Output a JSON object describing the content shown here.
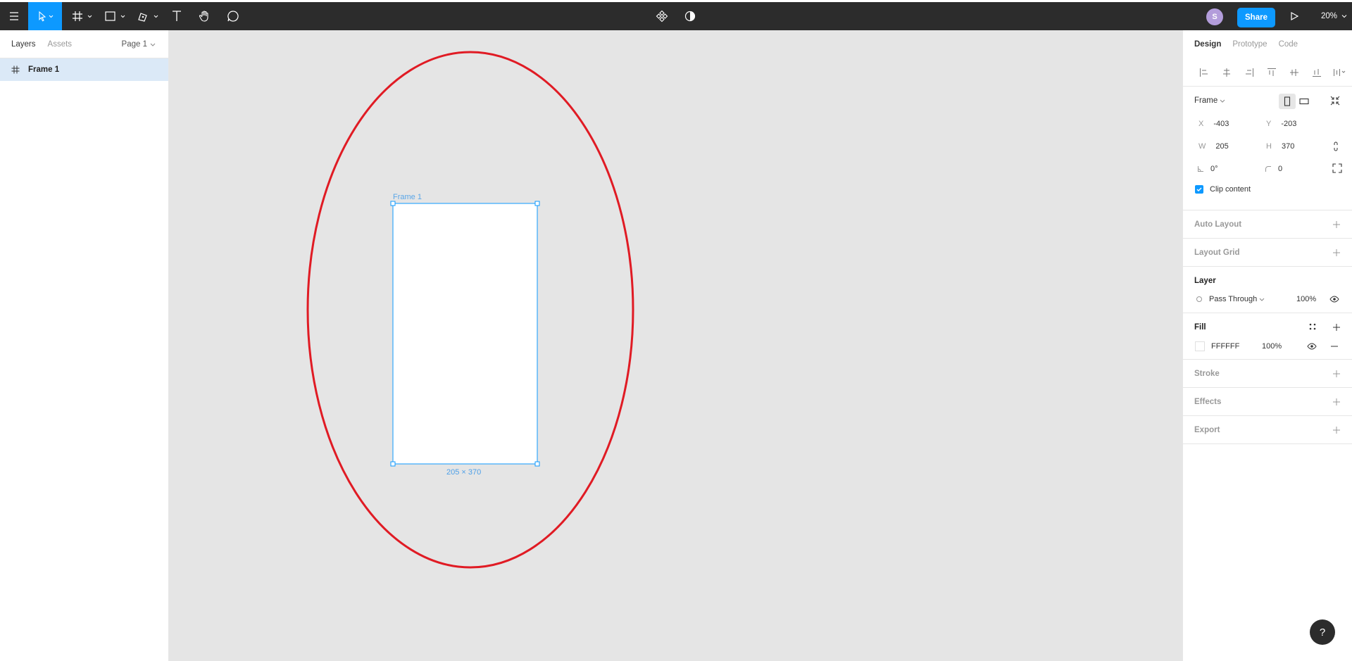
{
  "topbar": {
    "avatar_initial": "S",
    "share_label": "Share",
    "zoom_label": "20%"
  },
  "left_panel": {
    "tabs": [
      "Layers",
      "Assets"
    ],
    "page_select": "Page 1",
    "layers": [
      {
        "name": "Frame 1",
        "icon": "frame-icon"
      }
    ]
  },
  "canvas": {
    "frame_label": "Frame 1",
    "frame_size": "205 × 370",
    "background": "#e5e5e5",
    "annotation_color": "#e01b24",
    "selection_color": "#0d99ff"
  },
  "right_panel": {
    "tabs": [
      "Design",
      "Prototype",
      "Code"
    ],
    "frame_type": "Frame",
    "x": {
      "label": "X",
      "value": "-403"
    },
    "y": {
      "label": "Y",
      "value": "-203"
    },
    "w": {
      "label": "W",
      "value": "205"
    },
    "h": {
      "label": "H",
      "value": "370"
    },
    "rotation": "0°",
    "radius": "0",
    "clip_content": "Clip content",
    "auto_layout": "Auto Layout",
    "layout_grid": "Layout Grid",
    "layer_title": "Layer",
    "blend_mode": "Pass Through",
    "layer_opacity": "100%",
    "fill_title": "Fill",
    "fill_hex": "FFFFFF",
    "fill_opacity": "100%",
    "stroke": "Stroke",
    "effects": "Effects",
    "export": "Export"
  },
  "help_label": "?"
}
